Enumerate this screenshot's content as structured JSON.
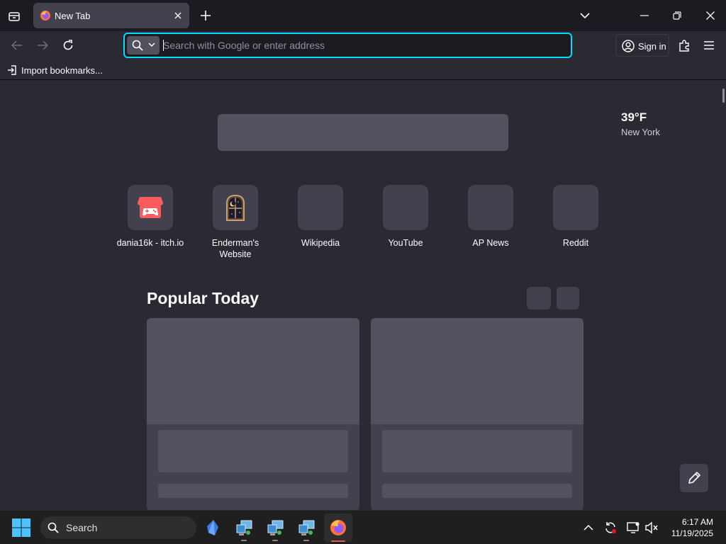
{
  "tab": {
    "title": "New Tab"
  },
  "urlbar": {
    "placeholder": "Search with Google or enter address"
  },
  "account": {
    "sign_in_label": "Sign in"
  },
  "bookmarks": {
    "import_label": "Import bookmarks..."
  },
  "weather": {
    "temperature": "39°F",
    "city": "New York"
  },
  "shortcuts": [
    {
      "label": "dania16k - itch.io",
      "icon": "itchio-icon"
    },
    {
      "label": "Enderman's Website",
      "icon": "window-moon-icon"
    },
    {
      "label": "Wikipedia",
      "icon": ""
    },
    {
      "label": "YouTube",
      "icon": ""
    },
    {
      "label": "AP News",
      "icon": ""
    },
    {
      "label": "Reddit",
      "icon": ""
    }
  ],
  "popular": {
    "title": "Popular Today"
  },
  "taskbar": {
    "search_label": "Search",
    "time": "6:17 AM",
    "date": "11/19/2025"
  },
  "colors": {
    "accent_focus": "#00ddff",
    "itch_red": "#fa5c5c",
    "firefox_orange": "#ff7139"
  }
}
